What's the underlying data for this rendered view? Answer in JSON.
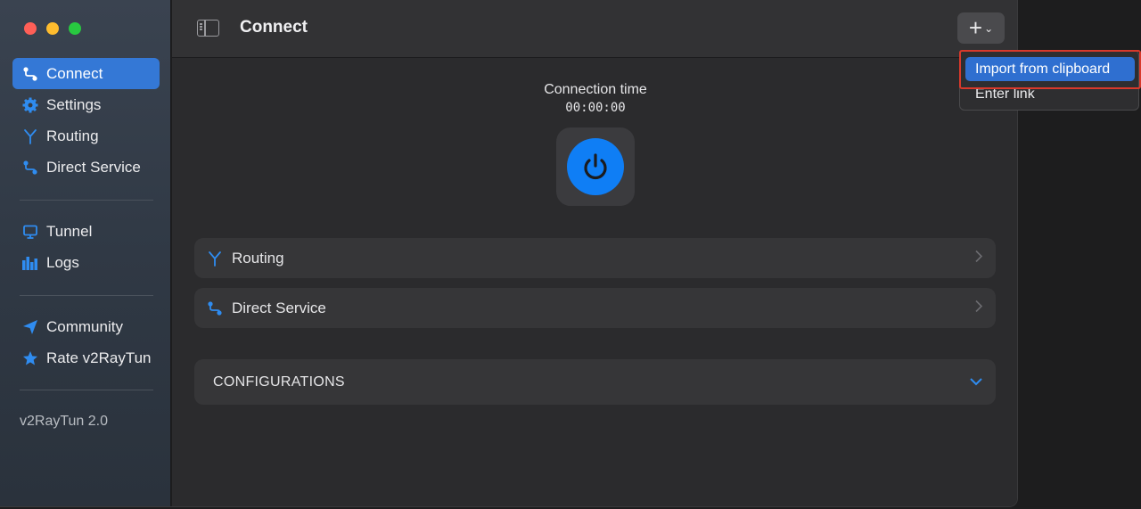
{
  "window_title": "Connect",
  "sidebar": {
    "items": [
      {
        "label": "Connect",
        "icon": "connect-icon"
      },
      {
        "label": "Settings",
        "icon": "gear-icon"
      },
      {
        "label": "Routing",
        "icon": "routing-icon"
      },
      {
        "label": "Direct Service",
        "icon": "direct-service-icon"
      },
      {
        "label": "Tunnel",
        "icon": "monitor-icon"
      },
      {
        "label": "Logs",
        "icon": "logs-icon"
      },
      {
        "label": "Community",
        "icon": "paper-plane-icon"
      },
      {
        "label": "Rate v2RayTun",
        "icon": "star-icon"
      }
    ],
    "version": "v2RayTun 2.0"
  },
  "main": {
    "connection_label": "Connection time",
    "connection_time": "00:00:00",
    "rows": {
      "routing": "Routing",
      "direct_service": "Direct Service",
      "configurations": "CONFIGURATIONS"
    }
  },
  "add_menu": {
    "import_label": "Import from clipboard",
    "enter_link_label": "Enter link"
  },
  "colors": {
    "accent": "#3478d6",
    "power": "#0f7ef5",
    "highlight_box": "#d8392b"
  }
}
